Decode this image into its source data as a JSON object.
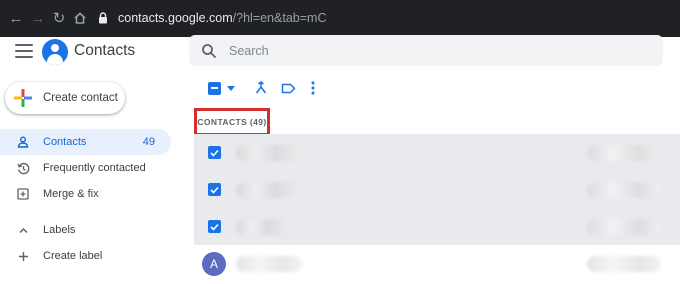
{
  "browser": {
    "url_host": "contacts.google.com",
    "url_rest": "/?hl=en&tab=mC"
  },
  "header": {
    "app_title": "Contacts",
    "search_placeholder": "Search"
  },
  "create_button": {
    "label": "Create contact"
  },
  "sidebar": {
    "items": [
      {
        "label": "Contacts",
        "count": "49",
        "icon": "person-icon",
        "active": true
      },
      {
        "label": "Frequently contacted",
        "icon": "history-icon"
      },
      {
        "label": "Merge & fix",
        "icon": "merge-fix-icon"
      },
      {
        "label": "Labels",
        "icon": "chevron-up-icon"
      },
      {
        "label": "Create label",
        "icon": "plus-icon"
      }
    ]
  },
  "toolbar": {
    "icons": [
      "select-all-checkbox-icon",
      "dropdown-caret-icon",
      "merge-icon",
      "label-icon",
      "more-vert-icon"
    ]
  },
  "list": {
    "heading": "CONTACTS (49)",
    "rows": [
      {
        "selected": true,
        "avatar": ""
      },
      {
        "selected": true,
        "avatar": ""
      },
      {
        "selected": true,
        "avatar": ""
      },
      {
        "selected": false,
        "avatar": "A"
      }
    ]
  },
  "colors": {
    "accent": "#1a73e8",
    "highlight_box": "#d32f2f",
    "selected_row": "#e8eaed",
    "active_nav": "#e8f0fe"
  }
}
